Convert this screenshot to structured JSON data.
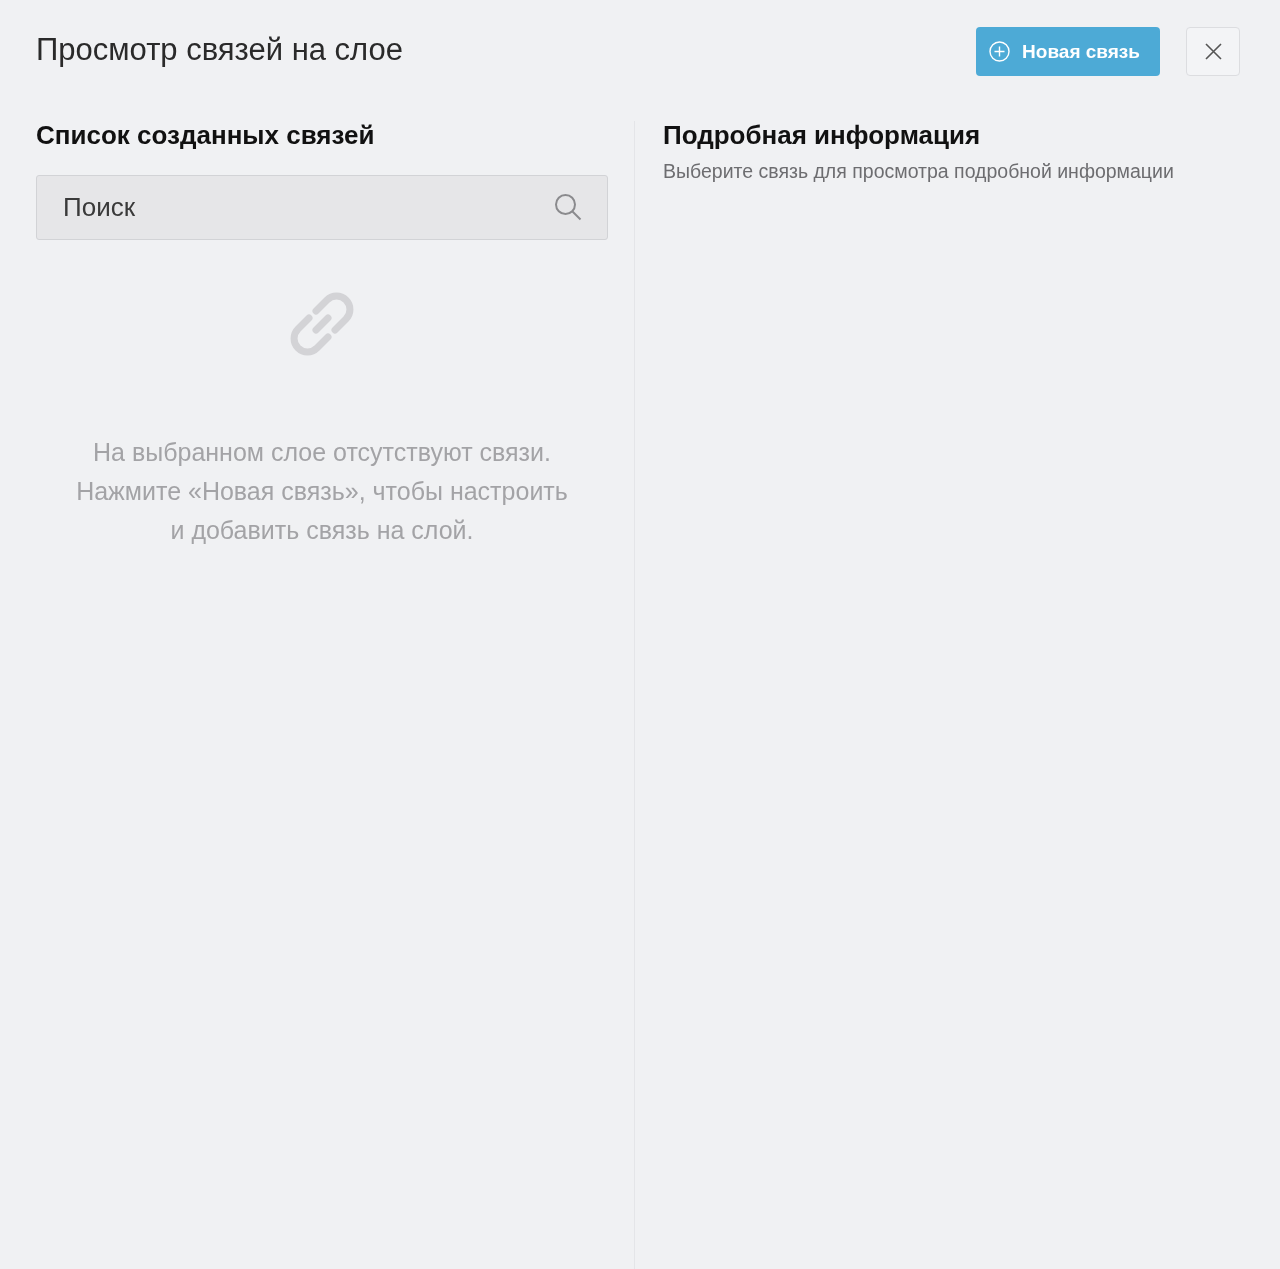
{
  "header": {
    "title": "Просмотр связей на слое",
    "new_button": "Новая связь"
  },
  "list_panel": {
    "title": "Список созданных связей",
    "search": {
      "placeholder": "Поиск"
    },
    "empty_message": "На выбранном слое отсутствуют связи.\nНажмите «Новая связь», чтобы настроить\nи добавить связь на слой."
  },
  "details_panel": {
    "title": "Подробная информация",
    "subtitle": "Выберите связь для просмотра подробной информации"
  }
}
